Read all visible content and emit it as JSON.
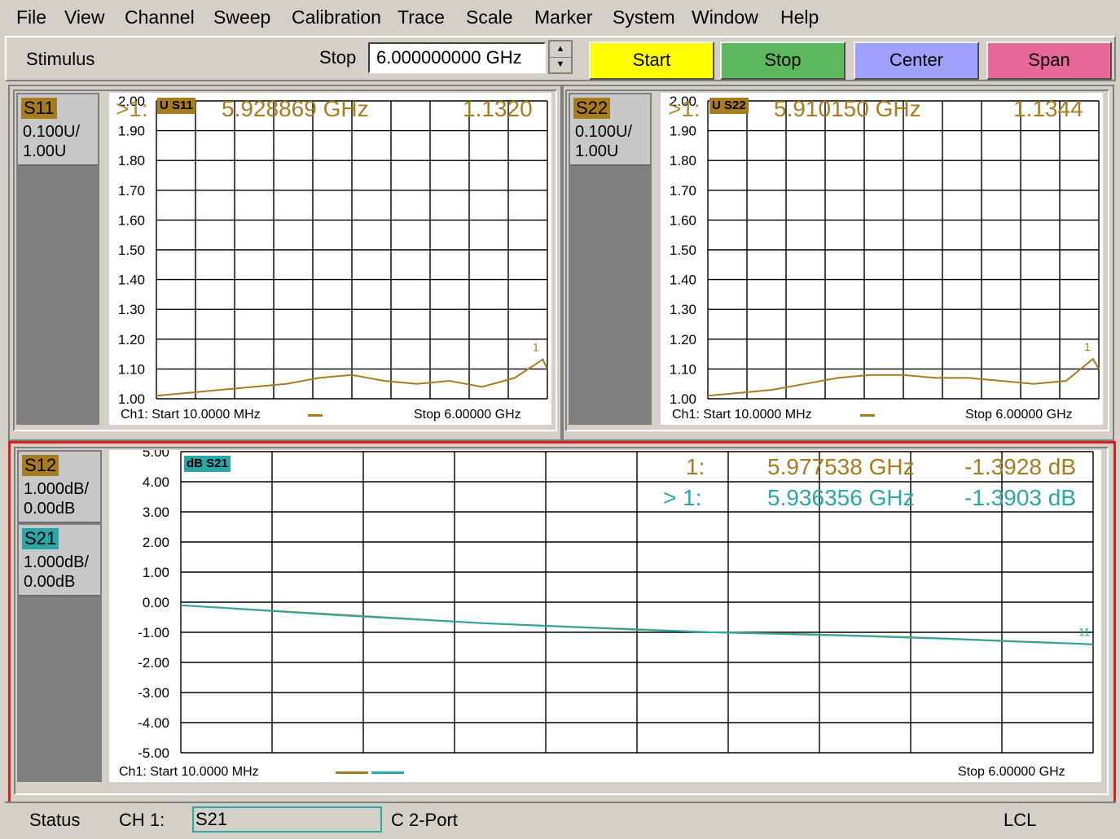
{
  "menu": [
    "File",
    "View",
    "Channel",
    "Sweep",
    "Calibration",
    "Trace",
    "Scale",
    "Marker",
    "System",
    "Window",
    "Help"
  ],
  "toolbar": {
    "stimulus_label": "Stimulus",
    "stop_label": "Stop",
    "stop_value": "6.000000000 GHz",
    "buttons": [
      {
        "label": "Start",
        "color": "#ffff00"
      },
      {
        "label": "Stop",
        "color": "#5cb85c"
      },
      {
        "label": "Center",
        "color": "#a0a0ff"
      },
      {
        "label": "Span",
        "color": "#e8689a"
      }
    ]
  },
  "colors": {
    "trace_brown": "#a67c1e",
    "trace_teal": "#2aa7a7",
    "active_border": "#d42020"
  },
  "panels": [
    {
      "trace": "S11",
      "scale": "0.100U/",
      "ref": "1.00U",
      "tag": "U S11",
      "marker": {
        "prefix": ">1:",
        "freq": "5.928869 GHz",
        "value": "1.1320"
      },
      "yticks": [
        "2.00",
        "1.90",
        "1.80",
        "1.70",
        "1.60",
        "1.50",
        "1.40",
        "1.30",
        "1.20",
        "1.10",
        "1.00"
      ],
      "footer_left": "Ch1: Start  10.0000 MHz",
      "footer_right": "Stop  6.00000 GHz",
      "marker_label": "1"
    },
    {
      "trace": "S22",
      "scale": "0.100U/",
      "ref": "1.00U",
      "tag": "U S22",
      "marker": {
        "prefix": ">1:",
        "freq": "5.910150 GHz",
        "value": "1.1344"
      },
      "yticks": [
        "2.00",
        "1.90",
        "1.80",
        "1.70",
        "1.60",
        "1.50",
        "1.40",
        "1.30",
        "1.20",
        "1.10",
        "1.00"
      ],
      "footer_left": "Ch1: Start  10.0000 MHz",
      "footer_right": "Stop  6.00000 GHz",
      "marker_label": "1"
    }
  ],
  "bottom_panel": {
    "traces": [
      {
        "name": "S12",
        "scale": "1.000dB/",
        "ref": "0.00dB"
      },
      {
        "name": "S21",
        "scale": "1.000dB/",
        "ref": "0.00dB"
      }
    ],
    "tag": "dB S21",
    "markers": [
      {
        "prefix": "1:",
        "freq": "5.977538 GHz",
        "value": "-1.3928 dB"
      },
      {
        "prefix": "> 1:",
        "freq": "5.936356 GHz",
        "value": "-1.3903 dB"
      }
    ],
    "yticks": [
      "5.00",
      "4.00",
      "3.00",
      "2.00",
      "1.00",
      "0.00",
      "-1.00",
      "-2.00",
      "-3.00",
      "-4.00",
      "-5.00"
    ],
    "footer_left": "Ch1: Start  10.0000 MHz",
    "footer_right": "Stop  6.00000 GHz",
    "marker_label": "11"
  },
  "chart_data": [
    {
      "type": "line",
      "title": "",
      "xlabel": "",
      "ylabel": "",
      "xlim": [
        0.01,
        6.0
      ],
      "ylim": [
        1.0,
        2.0
      ],
      "series": [
        {
          "name": "S11",
          "x": [
            0.01,
            0.5,
            1.0,
            1.5,
            2.0,
            2.5,
            3.0,
            3.5,
            4.0,
            4.5,
            5.0,
            5.5,
            5.93,
            6.0
          ],
          "values": [
            1.01,
            1.02,
            1.03,
            1.04,
            1.05,
            1.07,
            1.08,
            1.06,
            1.05,
            1.06,
            1.04,
            1.07,
            1.132,
            1.1
          ]
        }
      ]
    },
    {
      "type": "line",
      "title": "",
      "xlabel": "",
      "ylabel": "",
      "xlim": [
        0.01,
        6.0
      ],
      "ylim": [
        1.0,
        2.0
      ],
      "series": [
        {
          "name": "S22",
          "x": [
            0.01,
            0.5,
            1.0,
            1.5,
            2.0,
            2.5,
            3.0,
            3.5,
            4.0,
            4.5,
            5.0,
            5.5,
            5.91,
            6.0
          ],
          "values": [
            1.01,
            1.02,
            1.03,
            1.05,
            1.07,
            1.08,
            1.08,
            1.07,
            1.07,
            1.06,
            1.05,
            1.06,
            1.134,
            1.1
          ]
        }
      ]
    },
    {
      "type": "line",
      "title": "",
      "xlabel": "",
      "ylabel": "",
      "xlim": [
        0.01,
        6.0
      ],
      "ylim": [
        -5.0,
        5.0
      ],
      "series": [
        {
          "name": "S12",
          "x": [
            0.01,
            0.5,
            1.0,
            1.5,
            2.0,
            2.5,
            3.0,
            3.5,
            4.0,
            4.5,
            5.0,
            5.5,
            5.98,
            6.0
          ],
          "values": [
            -0.1,
            -0.25,
            -0.4,
            -0.55,
            -0.7,
            -0.8,
            -0.9,
            -1.0,
            -1.05,
            -1.12,
            -1.2,
            -1.3,
            -1.393,
            -1.4
          ]
        },
        {
          "name": "S21",
          "x": [
            0.01,
            0.5,
            1.0,
            1.5,
            2.0,
            2.5,
            3.0,
            3.5,
            4.0,
            4.5,
            5.0,
            5.5,
            5.94,
            6.0
          ],
          "values": [
            -0.1,
            -0.26,
            -0.42,
            -0.56,
            -0.7,
            -0.81,
            -0.91,
            -1.0,
            -1.06,
            -1.13,
            -1.21,
            -1.31,
            -1.39,
            -1.41
          ]
        }
      ]
    }
  ],
  "status": {
    "label": "Status",
    "channel": "CH 1:",
    "field": "S21",
    "mode": "C  2-Port",
    "remote": "LCL"
  }
}
